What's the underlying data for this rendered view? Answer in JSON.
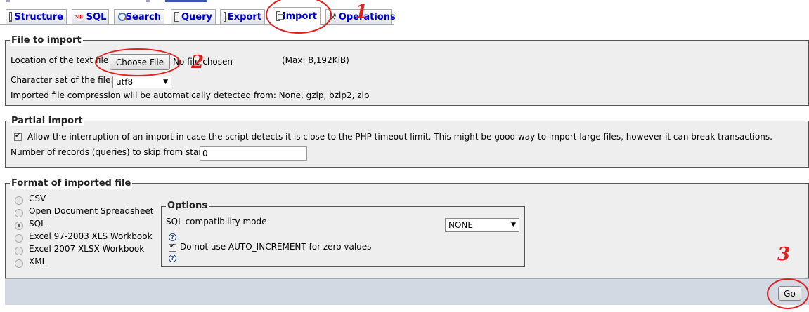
{
  "tabs": [
    {
      "label": "Structure",
      "icon": "structure-icon",
      "active": false
    },
    {
      "label": "SQL",
      "icon": "sql-icon",
      "active": false
    },
    {
      "label": "Search",
      "icon": "search-icon",
      "active": false
    },
    {
      "label": "Query",
      "icon": "query-icon",
      "active": false
    },
    {
      "label": "Export",
      "icon": "export-icon",
      "active": false
    },
    {
      "label": "Import",
      "icon": "import-icon",
      "active": true
    },
    {
      "label": "Operations",
      "icon": "operations-icon",
      "active": false
    }
  ],
  "file_to_import": {
    "legend": "File to import",
    "location_label": "Location of the text file",
    "choose_file_label": "Choose File",
    "no_file_text": "No file chosen",
    "max_size": "(Max: 8,192KiB)",
    "charset_label": "Character set of the file:",
    "charset_value": "utf8",
    "compression_note": "Imported file compression will be automatically detected from: None, gzip, bzip2, zip"
  },
  "partial_import": {
    "legend": "Partial import",
    "allow_interrupt_label": "Allow the interruption of an import in case the script detects it is close to the PHP timeout limit. This might be good way to import large files, however it can break transactions.",
    "allow_interrupt_checked": true,
    "skip_label": "Number of records (queries) to skip from start",
    "skip_value": "0"
  },
  "format": {
    "legend": "Format of imported file",
    "options": [
      {
        "label": "CSV",
        "selected": false
      },
      {
        "label": "Open Document Spreadsheet",
        "selected": false
      },
      {
        "label": "SQL",
        "selected": true
      },
      {
        "label": "Excel 97-2003 XLS Workbook",
        "selected": false
      },
      {
        "label": "Excel 2007 XLSX Workbook",
        "selected": false
      },
      {
        "label": "XML",
        "selected": false
      }
    ],
    "options_box": {
      "legend": "Options",
      "compat_label": "SQL compatibility mode",
      "compat_value": "NONE",
      "auto_increment_label": "Do not use AUTO_INCREMENT for zero values",
      "auto_increment_checked": true,
      "help_glyph": "?"
    }
  },
  "footer": {
    "go_label": "Go"
  },
  "annotations": {
    "color": "#e0201e",
    "marks": [
      "1",
      "2",
      "3"
    ]
  },
  "colors": {
    "tab_text": "#0000cc",
    "panel_bg": "#eeeeee",
    "footer_bg": "#d2d9e3"
  }
}
